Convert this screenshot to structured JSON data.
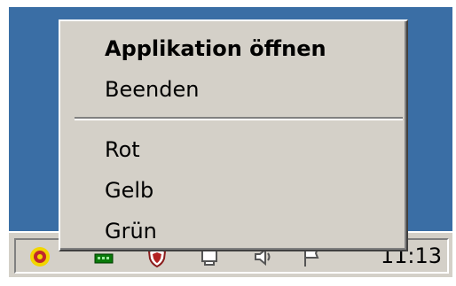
{
  "menu": {
    "items": [
      {
        "label": "Applikation öffnen",
        "default": true
      },
      {
        "label": "Beenden"
      },
      {
        "label": "Rot"
      },
      {
        "label": "Gelb"
      },
      {
        "label": "Grün"
      }
    ]
  },
  "tray": {
    "icons": [
      "color-app-icon",
      "network-icon",
      "security-shield-icon",
      "computer-icon",
      "volume-icon",
      "flag-icon"
    ],
    "clock": "11:13"
  },
  "colors": {
    "desktop": "#3a6ea5",
    "menu_face": "#d4d0c8"
  }
}
